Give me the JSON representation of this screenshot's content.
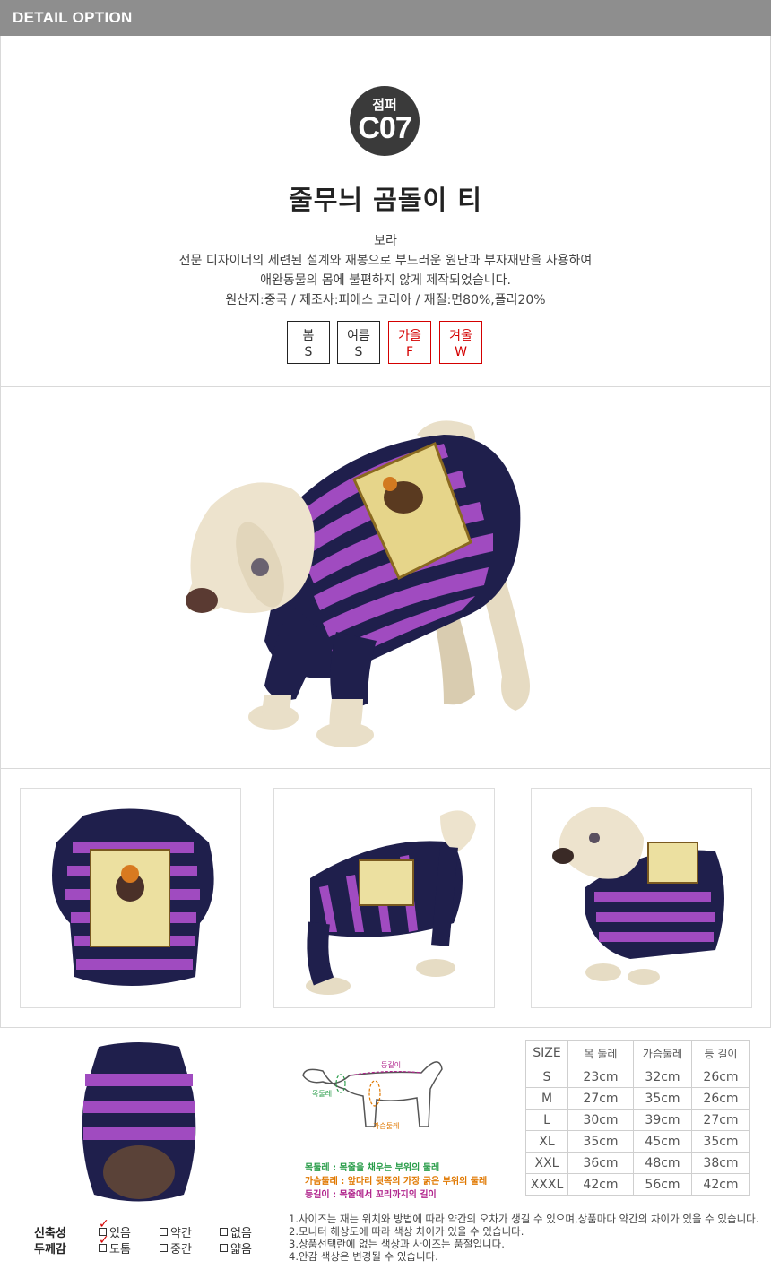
{
  "header": {
    "title": "DETAIL OPTION"
  },
  "product": {
    "category": "점퍼",
    "code": "C07",
    "name": "줄무늬 곰돌이 티",
    "color": "보라",
    "description_line1": "전문 디자이너의 세련된 설계와 재봉으로 부드러운 원단과 부자재만을 사용하여",
    "description_line2": "애완동물의 몸에 불편하지 않게 제작되었습니다.",
    "origin": "원산지:중국 / 제조사:피에스 코리아 / 재질:면80%,폴리20%"
  },
  "seasons": [
    {
      "name": "봄",
      "size": "S"
    },
    {
      "name": "여름",
      "size": "S"
    },
    {
      "name": "가을",
      "size": "F"
    },
    {
      "name": "겨울",
      "size": "W"
    }
  ],
  "colors": {
    "badge": "#3a3a3a",
    "topbar": "#8e8e8e",
    "season_red": "#d40000",
    "stripe_purple": "#a04bc0",
    "navy": "#1f1f4c",
    "mannequin": "#e9dfc8"
  },
  "diagram_labels": {
    "back": "등길이",
    "neck": "목둘레",
    "chest": "가슴둘레"
  },
  "legend": [
    {
      "text": "목둘레 : 목줄을 채우는 부위의 둘레",
      "color": "#2a9d4a"
    },
    {
      "text": "가슴둘레 : 앞다리 뒷쪽의 가장 굵은 부위의 둘레",
      "color": "#e07800"
    },
    {
      "text": "등길이 : 목줄에서 꼬리까지의 길이",
      "color": "#b0248c"
    }
  ],
  "size_table": {
    "headers": [
      "SIZE",
      "목 둘레",
      "가슴둘레",
      "등 길이"
    ],
    "rows": [
      [
        "S",
        "23cm",
        "32cm",
        "26cm"
      ],
      [
        "M",
        "27cm",
        "35cm",
        "26cm"
      ],
      [
        "L",
        "30cm",
        "39cm",
        "27cm"
      ],
      [
        "XL",
        "35cm",
        "45cm",
        "35cm"
      ],
      [
        "XXL",
        "36cm",
        "48cm",
        "38cm"
      ],
      [
        "XXXL",
        "42cm",
        "56cm",
        "42cm"
      ]
    ]
  },
  "attributes": {
    "stretch": {
      "label": "신축성",
      "options": [
        "있음",
        "약간",
        "없음"
      ],
      "selected": "있음"
    },
    "thickness": {
      "label": "두께감",
      "options": [
        "도톰",
        "중간",
        "얇음"
      ],
      "selected": "도톰"
    }
  },
  "notes": [
    "1.사이즈는 재는 위치와 방법에 따라 약간의 오차가 생길 수 있으며,상품마다 약간의 차이가 있을 수 있습니다.",
    "2.모니터 해상도에 따라 색상 차이가 있을 수 있습니다.",
    "3.상품선택란에 없는 색상과 사이즈는 품절입니다.",
    "4.안감 색상은 변경될 수 있습니다."
  ]
}
